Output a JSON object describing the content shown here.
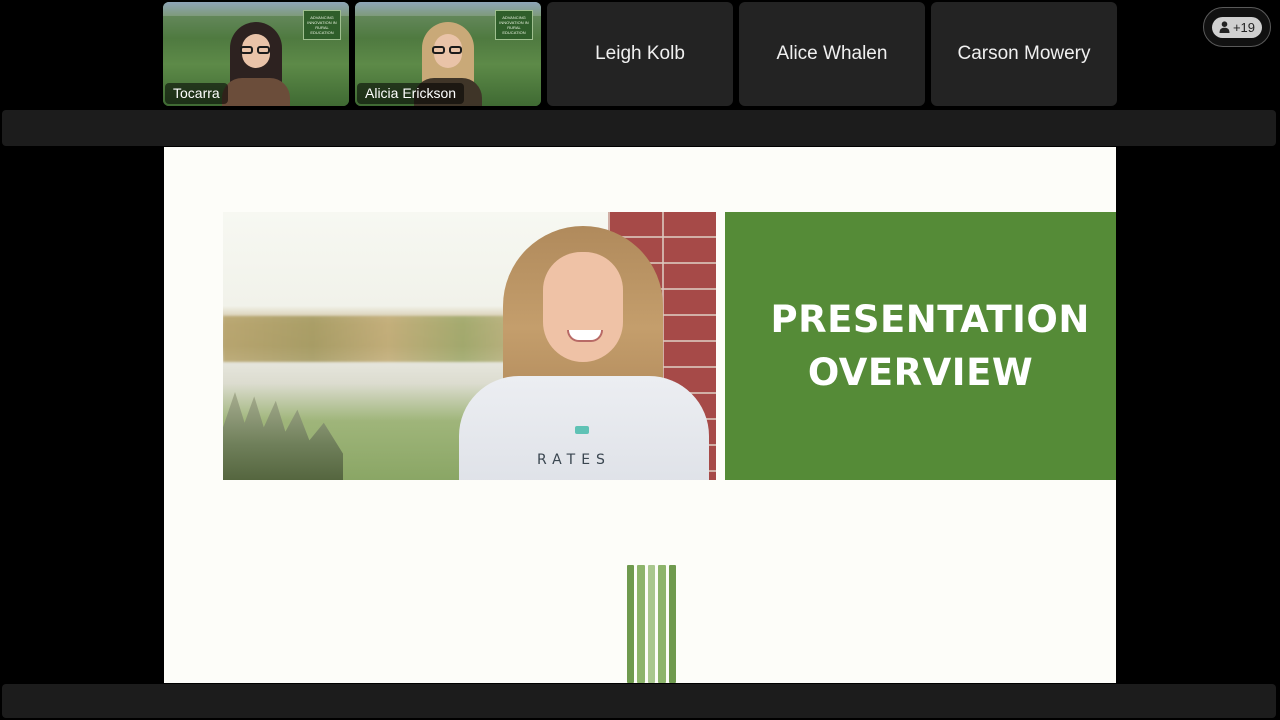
{
  "participants": {
    "video_tiles": [
      {
        "name": "Tocarra",
        "banner": "ADVANCING INNOVATION IN RURAL EDUCATION"
      },
      {
        "name": "Alicia Erickson",
        "banner": "ADVANCING INNOVATION IN RURAL EDUCATION"
      }
    ],
    "name_tiles": [
      {
        "name": "Leigh Kolb"
      },
      {
        "name": "Alice Whalen"
      },
      {
        "name": "Carson Mowery"
      }
    ],
    "more_count": "+19"
  },
  "slide": {
    "title": "PRESENTATION OVERVIEW",
    "photo_caption": "RATES",
    "accent_color": "#558b37"
  }
}
